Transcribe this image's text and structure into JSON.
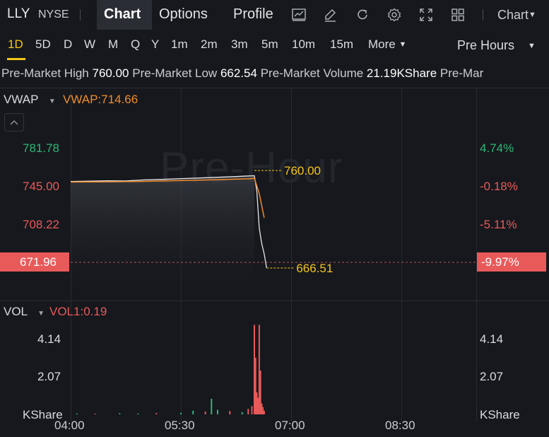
{
  "header": {
    "ticker": "LLY",
    "exchange": "NYSE",
    "tabs": [
      "Chart",
      "Options",
      "Profile"
    ],
    "active_tab": "Chart",
    "chart_menu_label": "Chart",
    "icons": [
      "chart-style-icon",
      "draw-icon",
      "refresh-icon",
      "settings-icon",
      "fullscreen-icon",
      "layout-grid-icon"
    ]
  },
  "periods": {
    "items": [
      "1D",
      "5D",
      "D",
      "W",
      "M",
      "Q",
      "Y",
      "1m",
      "2m",
      "3m",
      "5m",
      "10m",
      "15m"
    ],
    "more_label": "More",
    "active": "1D",
    "session_label": "Pre Hours"
  },
  "premarket": {
    "high_label": "Pre-Market High",
    "high_value": "760.00",
    "low_label": "Pre-Market Low",
    "low_value": "662.54",
    "volume_label": "Pre-Market Volume",
    "volume_value": "21.19KShare",
    "trailing_label": "Pre-Mar"
  },
  "indicator": {
    "name": "VWAP",
    "value_label": "VWAP:714.66"
  },
  "volume_panel": {
    "name": "VOL",
    "value_label": "VOL1:0.19"
  },
  "watermark": "Pre-Hour",
  "colors": {
    "up": "#2fb677",
    "down": "#e85a5a",
    "vwap": "#f08c2a",
    "highlight": "#f5c518",
    "background": "#16181d"
  },
  "chart_data": [
    {
      "type": "line",
      "title": "",
      "x_ticks": [
        "04:00",
        "05:30",
        "07:00",
        "08:30"
      ],
      "y_ticks": [
        "781.78",
        "745.00",
        "708.22",
        "671.96"
      ],
      "y_ticks_right": [
        "4.74%",
        "-0.18%",
        "-5.11%",
        "-9.97%"
      ],
      "ylim": [
        660,
        790
      ],
      "current_price": "671.96",
      "current_change": "-9.97%",
      "annotations": [
        {
          "label": "760.00",
          "value": 760.0
        },
        {
          "label": "666.51",
          "value": 666.51
        }
      ],
      "series": [
        {
          "name": "Price",
          "x": [
            "04:00",
            "04:15",
            "04:30",
            "04:45",
            "05:00",
            "05:15",
            "05:30",
            "05:45",
            "06:00",
            "06:15",
            "06:25",
            "06:30",
            "06:32",
            "06:34",
            "06:36",
            "06:38",
            "06:40"
          ],
          "values": [
            749.5,
            749.8,
            750.2,
            750.0,
            751.0,
            751.5,
            752.2,
            752.8,
            753.5,
            754.2,
            754.8,
            755.0,
            740.0,
            705.0,
            690.0,
            680.0,
            666.51
          ]
        },
        {
          "name": "VWAP",
          "x": [
            "04:00",
            "04:30",
            "05:00",
            "05:30",
            "06:00",
            "06:25",
            "06:30",
            "06:34",
            "06:38"
          ],
          "values": [
            749.0,
            749.2,
            749.6,
            750.3,
            751.2,
            752.0,
            752.5,
            738.0,
            714.66
          ]
        }
      ]
    },
    {
      "type": "bar",
      "title": "",
      "x_ticks": [
        "04:00",
        "05:30",
        "07:00",
        "08:30"
      ],
      "y_ticks": [
        "4.14",
        "2.07",
        "KShare"
      ],
      "ylim": [
        0,
        5.0
      ],
      "series": [
        {
          "name": "VOL",
          "x": [
            "04:05",
            "04:20",
            "04:40",
            "04:55",
            "05:10",
            "05:30",
            "05:40",
            "05:50",
            "05:55",
            "06:00",
            "06:10",
            "06:20",
            "06:25",
            "06:28",
            "06:30",
            "06:31",
            "06:32",
            "06:33",
            "06:34",
            "06:35",
            "06:36",
            "06:37",
            "06:38"
          ],
          "values": [
            0.05,
            0.04,
            0.06,
            0.05,
            0.07,
            0.08,
            0.2,
            0.15,
            0.85,
            0.25,
            0.18,
            0.12,
            0.3,
            0.45,
            4.9,
            3.1,
            1.2,
            0.9,
            4.9,
            2.4,
            0.6,
            0.4,
            0.2
          ],
          "direction": [
            "up",
            "down",
            "up",
            "up",
            "down",
            "up",
            "up",
            "down",
            "up",
            "up",
            "down",
            "up",
            "down",
            "down",
            "down",
            "down",
            "down",
            "down",
            "down",
            "down",
            "down",
            "down",
            "down"
          ]
        }
      ]
    }
  ]
}
